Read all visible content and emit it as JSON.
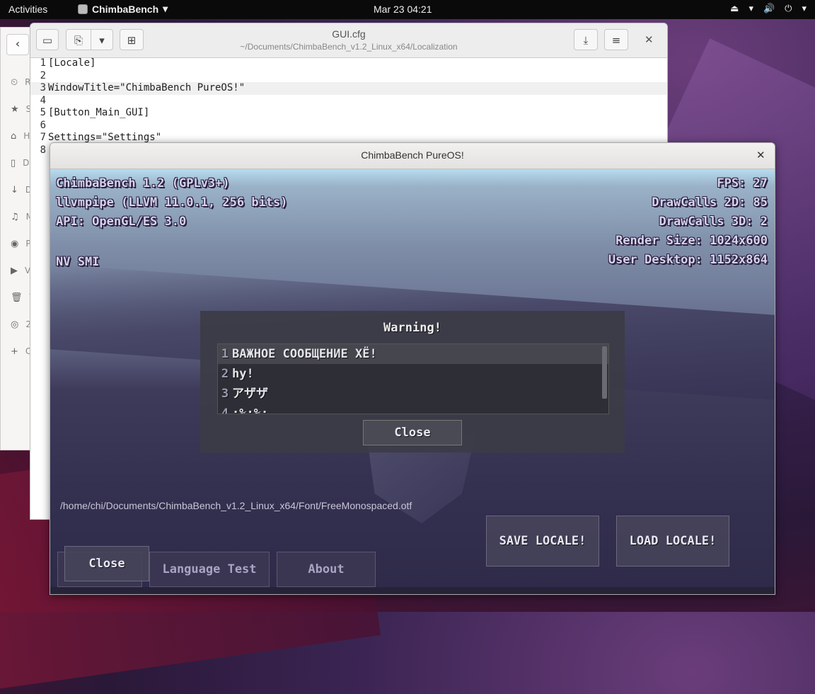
{
  "topbar": {
    "activities": "Activities",
    "app_name": "ChimbaBench",
    "app_dropdown": "▾",
    "clock": "Mar 23  04:21",
    "tray": [
      "⏏",
      "▾",
      "🔊",
      "⏻",
      "▾"
    ]
  },
  "files": {
    "back": "‹",
    "items": [
      {
        "icon": "⏲",
        "label": "R"
      },
      {
        "icon": "★",
        "label": "S"
      },
      {
        "icon": "⌂",
        "label": "H"
      },
      {
        "icon": "▯",
        "label": "D"
      },
      {
        "icon": "↓",
        "label": "D"
      },
      {
        "icon": "♫",
        "label": "M"
      },
      {
        "icon": "◉",
        "label": "P"
      },
      {
        "icon": "▶",
        "label": "V"
      },
      {
        "icon": "🗑",
        "label": "T"
      },
      {
        "icon": "◎",
        "label": "2"
      },
      {
        "icon": "+",
        "label": "O"
      }
    ]
  },
  "gedit": {
    "title": "GUI.cfg",
    "subtitle": "~/Documents/ChimbaBench_v1.2_Linux_x64/Localization",
    "btn_sidebar": "▭",
    "btn_open": "⎘",
    "btn_dropdown": "▾",
    "btn_new": "⊞",
    "btn_save": "⤓",
    "btn_menu": "≡",
    "btn_close": "✕",
    "lines": [
      {
        "n": "1",
        "text": "[Locale]"
      },
      {
        "n": "2",
        "text": ""
      },
      {
        "n": "3",
        "text": "WindowTitle=\"ChimbaBench PureOS!\""
      },
      {
        "n": "4",
        "text": ""
      },
      {
        "n": "5",
        "text": "[Button_Main_GUI]"
      },
      {
        "n": "6",
        "text": ""
      },
      {
        "n": "7",
        "text": "Settings=\"Settings\""
      },
      {
        "n": "8",
        "text": ""
      }
    ]
  },
  "cb": {
    "window_title": "ChimbaBench PureOS!",
    "close_x": "✕",
    "hud_left": [
      "ChimbaBench 1.2 (GPLv3+)",
      "llvmpipe (LLVM 11.0.1, 256 bits)",
      "API: OpenGL/ES 3.0"
    ],
    "hud_left_extra": "NV SMI",
    "hud_right": [
      "FPS: 27",
      "DrawCalls 2D: 85",
      "DrawCalls 3D: 2",
      "Render Size: 1024x600",
      "User Desktop: 1152x864"
    ],
    "warning": {
      "title": "Warning!",
      "rows": [
        {
          "n": "1",
          "text": "ВАЖНОЕ СООБЩЕНИЕ ХЁ!"
        },
        {
          "n": "2",
          "text": "hy!"
        },
        {
          "n": "3",
          "text": "アザザ"
        },
        {
          "n": "4",
          "text": ":%:%:"
        }
      ],
      "close": "Close"
    },
    "font_path": "/home/chi/Documents/ChimbaBench_v1.2_Linux_x64/Font/FreeMonospaced.otf",
    "save_locale": "SAVE LOCALE!",
    "load_locale": "LOAD LOCALE!",
    "tab_close": "Close",
    "tab_language": "Language Test",
    "tab_about": "About"
  }
}
